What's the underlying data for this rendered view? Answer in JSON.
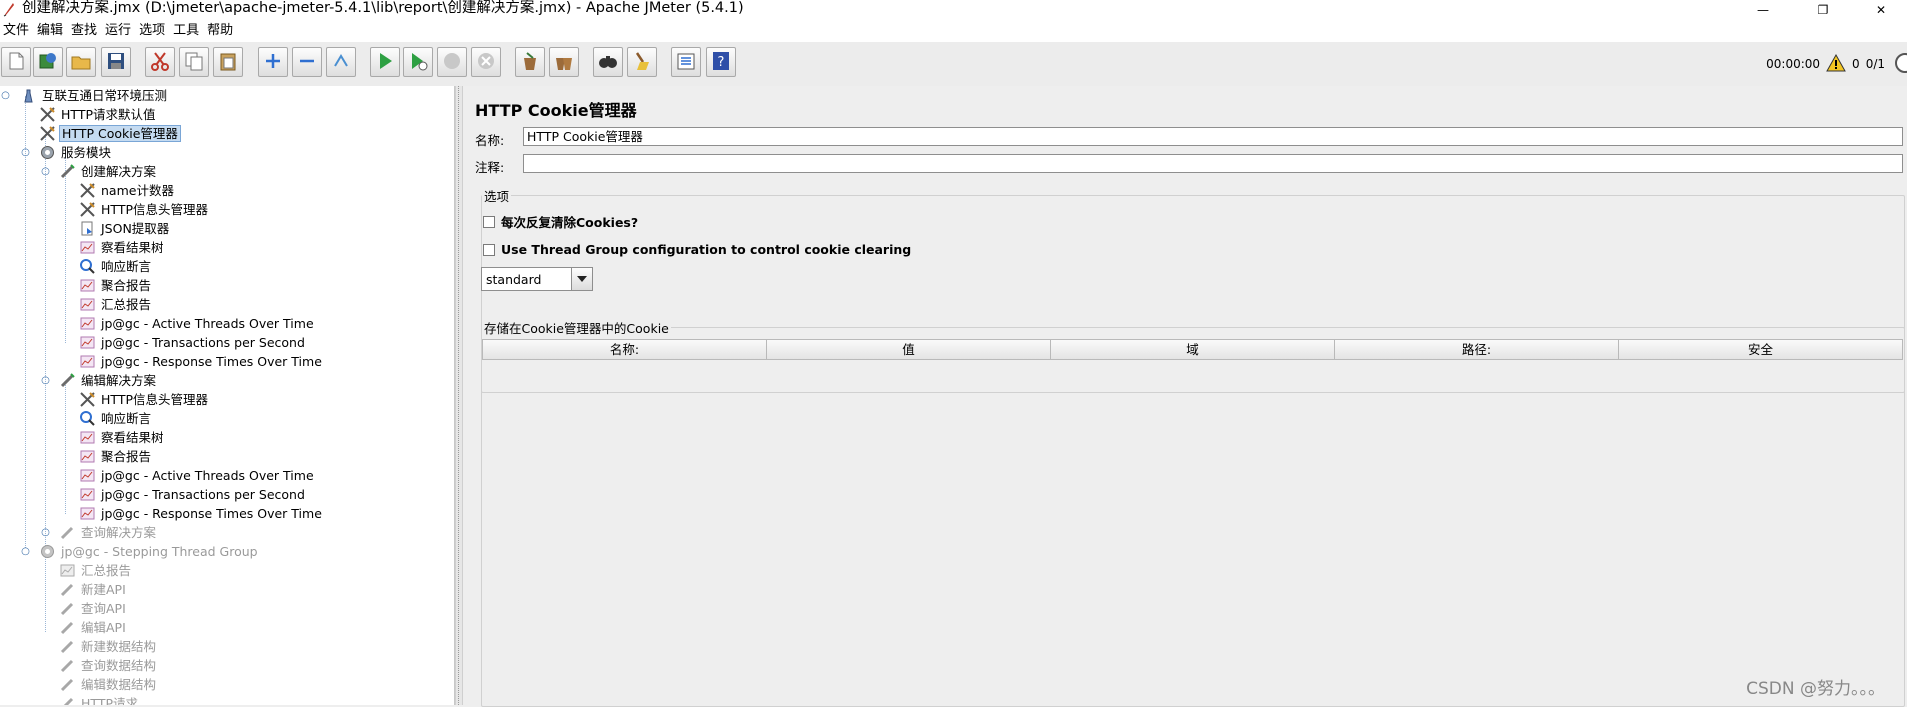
{
  "window": {
    "title": "创建解决方案.jmx (D:\\jmeter\\apache-jmeter-5.4.1\\lib\\report\\创建解决方案.jmx) - Apache JMeter (5.4.1)",
    "minimize_glyph": "—",
    "maximize_glyph": "❐",
    "close_glyph": "✕"
  },
  "menu": [
    "文件",
    "编辑",
    "查找",
    "运行",
    "选项",
    "工具",
    "帮助"
  ],
  "toolbar": {
    "buttons": [
      {
        "name": "new-icon"
      },
      {
        "name": "templates-icon"
      },
      {
        "name": "open-icon"
      },
      {
        "name": "save-icon"
      },
      {
        "name": "cut-icon"
      },
      {
        "name": "copy-icon"
      },
      {
        "name": "paste-icon"
      },
      {
        "name": "expand-icon"
      },
      {
        "name": "collapse-icon"
      },
      {
        "name": "toggle-icon"
      },
      {
        "name": "start-icon"
      },
      {
        "name": "start-no-pause-icon"
      },
      {
        "name": "stop-icon"
      },
      {
        "name": "shutdown-icon"
      },
      {
        "name": "clear-icon"
      },
      {
        "name": "clear-all-icon"
      },
      {
        "name": "search-icon"
      },
      {
        "name": "reset-search-icon"
      },
      {
        "name": "function-helper-icon"
      },
      {
        "name": "help-icon"
      }
    ],
    "status": {
      "elapsed": "00:00:00",
      "warnings": "0",
      "threads": "0/1"
    }
  },
  "tree": {
    "nodes": [
      {
        "label": "互联互通日常环境压测",
        "icon": "test-plan-icon"
      },
      {
        "label": "HTTP请求默认值",
        "icon": "config-icon"
      },
      {
        "label": "HTTP Cookie管理器",
        "icon": "config-icon"
      },
      {
        "label": "服务模块",
        "icon": "thread-group-icon"
      },
      {
        "label": "创建解决方案",
        "icon": "sampler-icon"
      },
      {
        "label": "name计数器",
        "icon": "config-icon"
      },
      {
        "label": "HTTP信息头管理器",
        "icon": "config-icon"
      },
      {
        "label": "JSON提取器",
        "icon": "extractor-icon"
      },
      {
        "label": "察看结果树",
        "icon": "listener-icon"
      },
      {
        "label": "响应断言",
        "icon": "assertion-icon"
      },
      {
        "label": "聚合报告",
        "icon": "listener-icon"
      },
      {
        "label": "汇总报告",
        "icon": "listener-icon"
      },
      {
        "label": "jp@gc - Active Threads Over Time",
        "icon": "listener-icon"
      },
      {
        "label": "jp@gc - Transactions per Second",
        "icon": "listener-icon"
      },
      {
        "label": "jp@gc - Response Times Over Time",
        "icon": "listener-icon"
      },
      {
        "label": "编辑解决方案",
        "icon": "sampler-icon"
      },
      {
        "label": "HTTP信息头管理器",
        "icon": "config-icon"
      },
      {
        "label": "响应断言",
        "icon": "assertion-icon"
      },
      {
        "label": "察看结果树",
        "icon": "listener-icon"
      },
      {
        "label": "聚合报告",
        "icon": "listener-icon"
      },
      {
        "label": "jp@gc - Active Threads Over Time",
        "icon": "listener-icon"
      },
      {
        "label": "jp@gc - Transactions per Second",
        "icon": "listener-icon"
      },
      {
        "label": "jp@gc - Response Times Over Time",
        "icon": "listener-icon"
      },
      {
        "label": "查询解决方案",
        "icon": "sampler-icon"
      },
      {
        "label": "jp@gc - Stepping Thread Group",
        "icon": "thread-group-icon"
      },
      {
        "label": "汇总报告",
        "icon": "listener-icon"
      },
      {
        "label": "新建API",
        "icon": "sampler-icon"
      },
      {
        "label": "查询API",
        "icon": "sampler-icon"
      },
      {
        "label": "编辑API",
        "icon": "sampler-icon"
      },
      {
        "label": "新建数据结构",
        "icon": "sampler-icon"
      },
      {
        "label": "查询数据结构",
        "icon": "sampler-icon"
      },
      {
        "label": "编辑数据结构",
        "icon": "sampler-icon"
      },
      {
        "label": "HTTP请求",
        "icon": "sampler-icon"
      }
    ]
  },
  "panel": {
    "title": "HTTP Cookie管理器",
    "name_label": "名称:",
    "name_value": "HTTP Cookie管理器",
    "comment_label": "注释:",
    "comment_value": "",
    "options_title": "选项",
    "clear_each_iteration": "每次反复清除Cookies?",
    "use_thread_group": "Use Thread Group configuration to control cookie clearing",
    "policy_value": "standard",
    "stored_title": "存储在Cookie管理器中的Cookie",
    "columns": [
      "名称:",
      "值",
      "域",
      "路径:",
      "安全"
    ]
  },
  "watermark": "CSDN @努力。。。"
}
